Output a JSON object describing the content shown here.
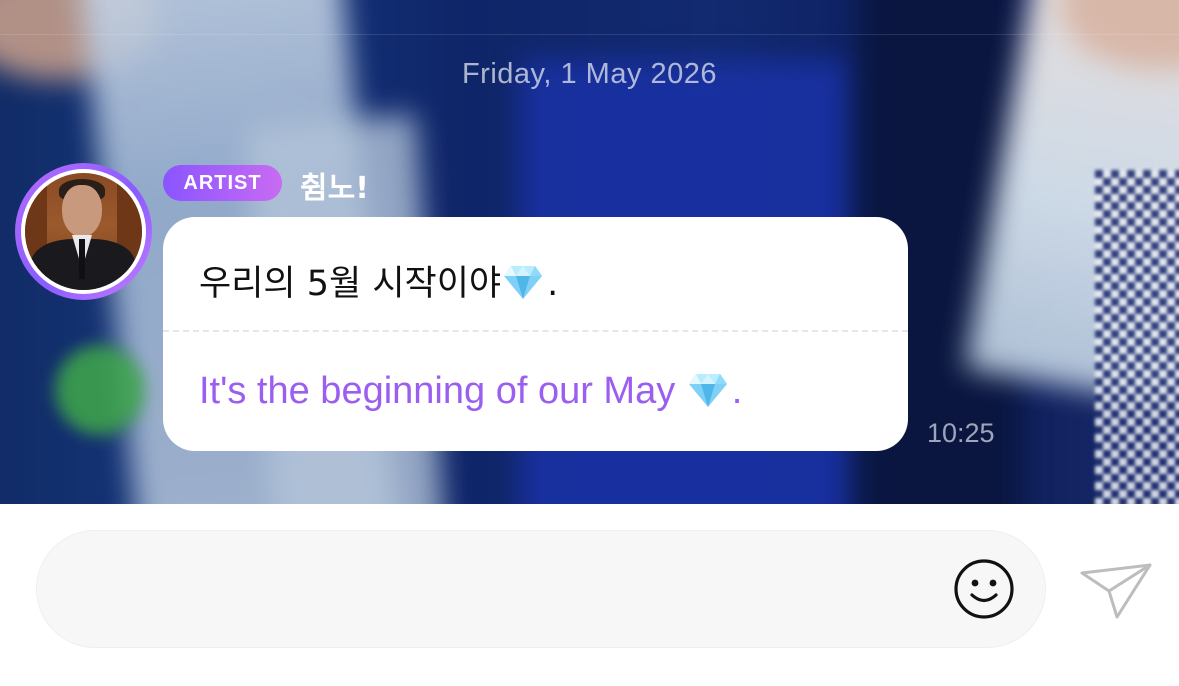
{
  "chat": {
    "date": "Friday, 1 May 2026"
  },
  "message": {
    "badge": "ARTIST",
    "sender": "췸노!",
    "original_text": "우리의 5월 시작이야",
    "original_suffix": ".",
    "translation_text": "It's the beginning of our May",
    "translation_suffix": ".",
    "time": "10:25"
  },
  "composer": {
    "placeholder": ""
  },
  "icons": {
    "emoji": "smiley-face-icon",
    "send": "paper-plane-icon",
    "gem": "gem-icon"
  },
  "colors": {
    "badge_gradient_start": "#8a55ff",
    "badge_gradient_end": "#c86bf2",
    "translation_text": "#9a5ef0",
    "avatar_ring": "#b46cff"
  }
}
